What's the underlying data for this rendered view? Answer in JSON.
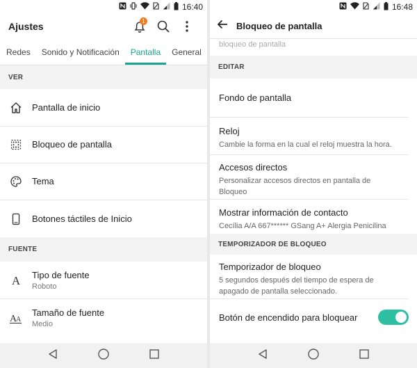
{
  "left": {
    "status": {
      "time": "16:40",
      "icons": [
        "nfc-icon",
        "vibrate-icon",
        "wifi-icon",
        "no-sim-icon",
        "signal-icon",
        "battery-icon"
      ]
    },
    "header": {
      "title": "Ajustes",
      "notification_badge": "1"
    },
    "tabs": [
      {
        "label": "Redes",
        "active": false
      },
      {
        "label": "Sonido y Notificación",
        "active": false
      },
      {
        "label": "Pantalla",
        "active": true
      },
      {
        "label": "General",
        "active": false
      }
    ],
    "section_ver": "VER",
    "items_ver": [
      {
        "label": "Pantalla de inicio",
        "icon": "home-icon"
      },
      {
        "label": "Bloqueo de pantalla",
        "icon": "lock-screen-icon"
      },
      {
        "label": "Tema",
        "icon": "palette-icon"
      },
      {
        "label": "Botones táctiles de Inicio",
        "icon": "phone-icon"
      }
    ],
    "section_fuente": "FUENTE",
    "items_fuente": [
      {
        "label": "Tipo de fuente",
        "sub": "Roboto",
        "icon": "font-type-icon"
      },
      {
        "label": "Tamaño de fuente",
        "sub": "Medio",
        "icon": "font-size-icon"
      }
    ]
  },
  "right": {
    "status": {
      "time": "16:48"
    },
    "header": {
      "title": "Bloqueo de pantalla"
    },
    "cut_text": "bloqueo de pantalla",
    "section_editar": "EDITAR",
    "items_editar": [
      {
        "label": "Fondo de pantalla",
        "sub": ""
      },
      {
        "label": "Reloj",
        "sub": "Cambie la forma en la cual el reloj muestra la hora."
      },
      {
        "label": "Accesos directos",
        "sub": "Personalizar accesos directos en pantalla de Bloqueo"
      },
      {
        "label": "Mostrar información de contacto",
        "sub": "Cecília A/A 667****** GSang A+ Alergia Penicilina"
      }
    ],
    "section_temp": "TEMPORIZADOR DE BLOQUEO",
    "items_temp": [
      {
        "label": "Temporizador de bloqueo",
        "sub": "5 segundos después del tiempo de espera de apagado de pantalla seleccionado."
      },
      {
        "label": "Botón de encendido para bloquear",
        "toggle": true
      }
    ]
  },
  "colors": {
    "accent": "#1aa38f",
    "toggle": "#2fc0a3",
    "badge": "#f47b20"
  }
}
